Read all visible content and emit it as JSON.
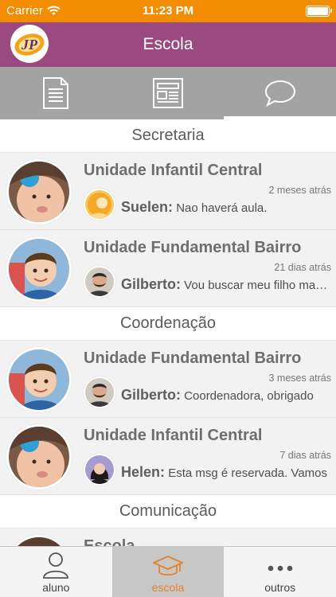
{
  "status": {
    "carrier": "Carrier",
    "time": "11:23 PM",
    "battery_level": 1.0
  },
  "header": {
    "title": "Escola",
    "logo_text": "JP"
  },
  "top_tabs": [
    {
      "icon": "document-icon",
      "active": false
    },
    {
      "icon": "newspaper-icon",
      "active": false
    },
    {
      "icon": "chat-bubble-icon",
      "active": true
    }
  ],
  "sections": [
    {
      "title": "Secretaria",
      "conversations": [
        {
          "title": "Unidade Infantil Central",
          "time": "2 meses atrás",
          "sender": "Suelen:",
          "message": "Nao haverá aula.",
          "avatar": "baby-girl-avatar",
          "sender_avatar": "suelen-avatar"
        },
        {
          "title": "Unidade Fundamental Bairro",
          "time": "21 dias atrás",
          "sender": "Gilberto:",
          "message": "Vou buscar meu filho mais cedo",
          "avatar": "boy-avatar",
          "sender_avatar": "gilberto-avatar"
        }
      ]
    },
    {
      "title": "Coordenação",
      "conversations": [
        {
          "title": "Unidade Fundamental Bairro",
          "time": "3 meses atrás",
          "sender": "Gilberto:",
          "message": "Coordenadora, obrigado",
          "avatar": "boy-avatar",
          "sender_avatar": "gilberto-avatar"
        },
        {
          "title": "Unidade Infantil Central",
          "time": "7 dias atrás",
          "sender": "Helen:",
          "message": "Esta msg é reservada. Vamos",
          "avatar": "baby-girl-avatar",
          "sender_avatar": "helen-avatar"
        }
      ]
    },
    {
      "title": "Comunicação",
      "conversations": [
        {
          "title": "Escola",
          "time": "",
          "sender": "",
          "message": "",
          "avatar": "baby-girl-avatar",
          "sender_avatar": ""
        }
      ]
    }
  ],
  "bottom_tabs": [
    {
      "label": "aluno",
      "icon": "person-icon",
      "active": false
    },
    {
      "label": "escola",
      "icon": "graduation-cap-icon",
      "active": true
    },
    {
      "label": "outros",
      "icon": "more-dots-icon",
      "active": false
    }
  ],
  "colors": {
    "status_bar": "#f28c00",
    "header": "#9b4a80",
    "tabs_bar": "#a3a3a3",
    "accent": "#e8822a"
  }
}
